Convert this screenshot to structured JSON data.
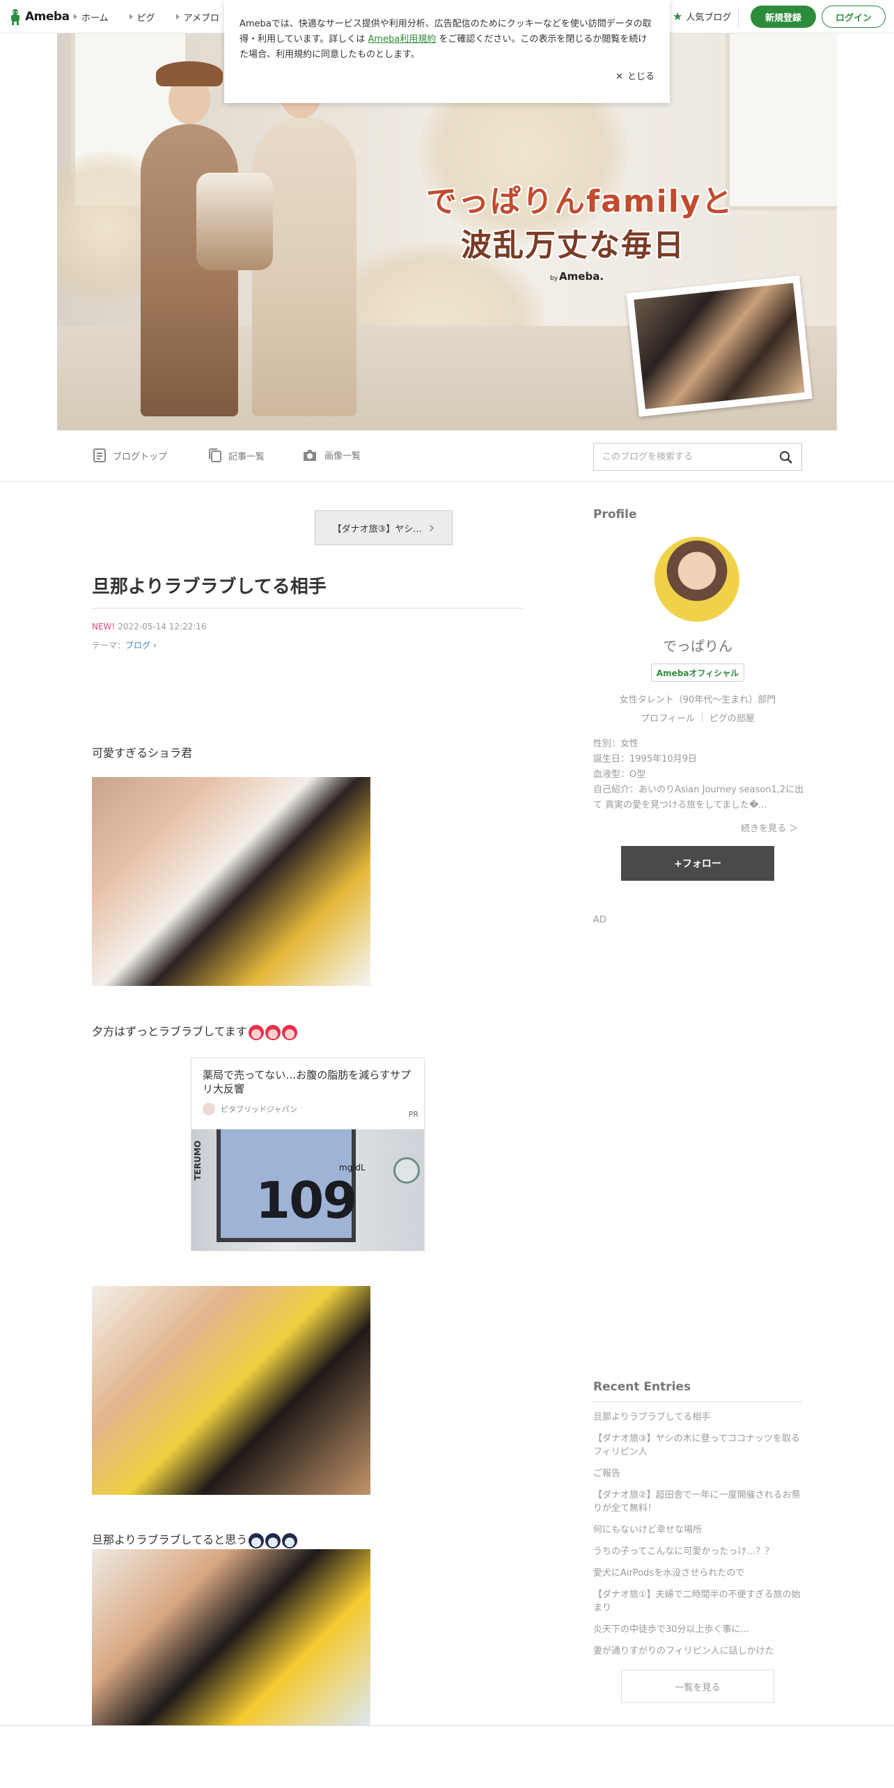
{
  "topnav": {
    "logo_text": "Ameba",
    "links": [
      "ホーム",
      "ピグ",
      "アメブロ"
    ],
    "popular": "人気ブログ",
    "register": "新規登録",
    "login": "ログイン",
    "brand_color": "#2d8c3c"
  },
  "cookie": {
    "text_before": "Amebaでは、快適なサービス提供や利用分析、広告配信のためにクッキーなどを使い訪問データの取得・利用しています。詳しくは ",
    "terms_link": "Ameba利用規約",
    "text_after": " をご確認ください。この表示を閉じるか閲覧を続けた場合、利用規約に同意したものとします。",
    "close_label": "とじる"
  },
  "banner": {
    "title_line1": "でっぱりんfamilyと",
    "title_line2": "波乱万丈な毎日",
    "by": "by",
    "ameba": "Ameba."
  },
  "subnav": {
    "blog_top": "ブログトップ",
    "entry_list": "記事一覧",
    "image_list": "画像一覧",
    "search_placeholder": "このブログを検索する"
  },
  "article": {
    "prev_entry": "【ダナオ旅③】ヤシ...",
    "title": "旦那よりラブラブしてる相手",
    "new_badge": "NEW!",
    "date": "2022-05-14 12:22:16",
    "theme_label": "テーマ：",
    "theme_value": "ブログ",
    "para1": "可愛すぎるショラ君",
    "para2": "夕方はずっとラブラブしてます",
    "para3": "旦那よりラブラブしてると思う"
  },
  "ad": {
    "title": "薬局で売ってない…お腹の脂肪を減らすサプリ大反響",
    "source": "ピタブリッドジャパン",
    "pr": "PR",
    "meter_value": "109",
    "meter_unit": "mg/dL",
    "meter_brand": "TERUMO"
  },
  "profile": {
    "heading": "Profile",
    "name": "でっぱりん",
    "official": "Amebaオフィシャル",
    "category": "女性タレント（90年代～生まれ）部門",
    "link_profile": "プロフィール",
    "link_pigg": "ピグの部屋",
    "gender": "性別：女性",
    "birthday": "誕生日：1995年10月9日",
    "blood": "血液型：O型",
    "intro": "自己紹介：あいのりAsian Journey season1,2に出て 真実の愛を見つける旅をしてました�...",
    "more": "続きを見る ＞",
    "follow": "+フォロー"
  },
  "ad_label": "AD",
  "recent": {
    "heading": "Recent Entries",
    "items": [
      "旦那よりラブラブしてる相手",
      "【ダナオ旅③】ヤシの木に登ってココナッツを取るフィリピン人",
      "ご報告",
      "【ダナオ旅②】超田舎で一年に一度開催されるお祭りが全て無料！",
      "何にもないけど幸せな場所",
      "うちの子ってこんなに可愛かったっけ…？？",
      "愛犬にAirPodsを水没させられたので",
      "【ダナオ旅①】夫婦で二時間半の不便すぎる旅の始まり",
      "炎天下の中徒歩で30分以上歩く事に…",
      "妻が通りすがりのフィリピン人に話しかけた"
    ],
    "view_all": "一覧を見る"
  }
}
